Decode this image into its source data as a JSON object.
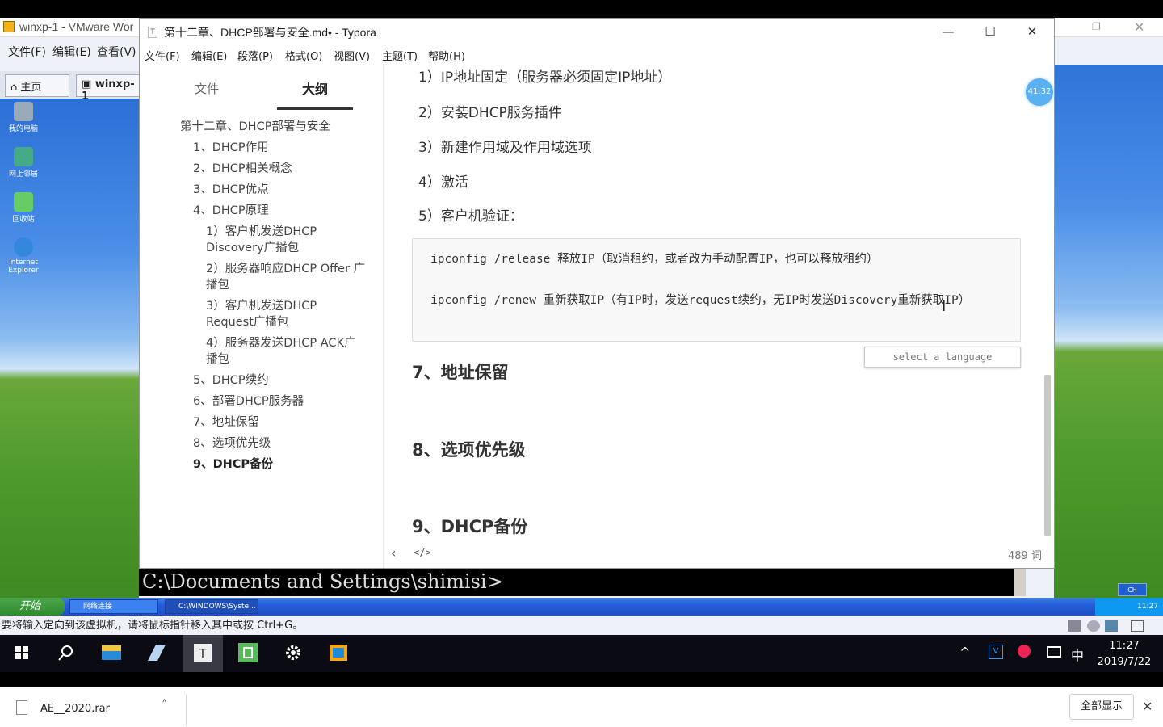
{
  "vm": {
    "title": "winxp-1 - VMware Wor",
    "menu": [
      "文件(F)",
      "编辑(E)",
      "查看(V)"
    ],
    "tabs": [
      "主页",
      "winxp-1"
    ],
    "desktop_icons": [
      "我的电脑",
      "网上邻居",
      "回收站",
      "Internet Explorer"
    ],
    "status_hint": "要将输入定向到该虚拟机，请将鼠标指针移入其中或按 Ctrl+G。"
  },
  "typora": {
    "title": "第十二章、DHCP部署与安全.md• - Typora",
    "menu": [
      "文件(F)",
      "编辑(E)",
      "段落(P)",
      "格式(O)",
      "视图(V)",
      "主题(T)",
      "帮助(H)"
    ],
    "sidebar_tabs": {
      "file": "文件",
      "outline": "大纲"
    },
    "outline": [
      {
        "label": "第十二章、DHCP部署与安全",
        "level": 0
      },
      {
        "label": "1、DHCP作用",
        "level": 1
      },
      {
        "label": "2、DHCP相关概念",
        "level": 1
      },
      {
        "label": "3、DHCP优点",
        "level": 1
      },
      {
        "label": "4、DHCP原理",
        "level": 1
      },
      {
        "label": "1）客户机发送DHCP Discovery广播包",
        "level": 2
      },
      {
        "label": "2）服务器响应DHCP Offer 广播包",
        "level": 2
      },
      {
        "label": "3）客户机发送DHCP Request广播包",
        "level": 2
      },
      {
        "label": "4）服务器发送DHCP ACK广播包",
        "level": 2
      },
      {
        "label": "5、DHCP续约",
        "level": 1
      },
      {
        "label": "6、部署DHCP服务器",
        "level": 1
      },
      {
        "label": "7、地址保留",
        "level": 1
      },
      {
        "label": "8、选项优先级",
        "level": 1
      },
      {
        "label": "9、DHCP备份",
        "level": 1,
        "active": true
      }
    ],
    "content": {
      "list": [
        "1）IP地址固定（服务器必须固定IP地址）",
        "2）安装DHCP服务插件",
        "3）新建作用域及作用域选项",
        "4）激活",
        "5）客户机验证："
      ],
      "code_lines": [
        "ipconfig  /release  释放IP（取消租约，或者改为手动配置IP，也可以释放租约）",
        "ipconfig  /renew  重新获取IP（有IP时，发送request续约，无IP时发送Discovery重新获取IP）"
      ],
      "lang_placeholder": "select a language",
      "headings": [
        "7、地址保留",
        "8、选项优先级",
        "9、DHCP备份"
      ]
    },
    "word_count": "489 词",
    "timer": "41:32"
  },
  "xp": {
    "cmd_prompt": "C:\\Documents and Settings\\shimisi>",
    "start": "开始",
    "task_buttons": [
      "网络连接",
      "C:\\WINDOWS\\Syste..."
    ],
    "tray_time": "11:27",
    "lang": "CH"
  },
  "win10": {
    "ime": "中",
    "time": "11:27",
    "date": "2019/7/22"
  },
  "download": {
    "filename": "AE__2020.rar",
    "show_all": "全部显示"
  }
}
